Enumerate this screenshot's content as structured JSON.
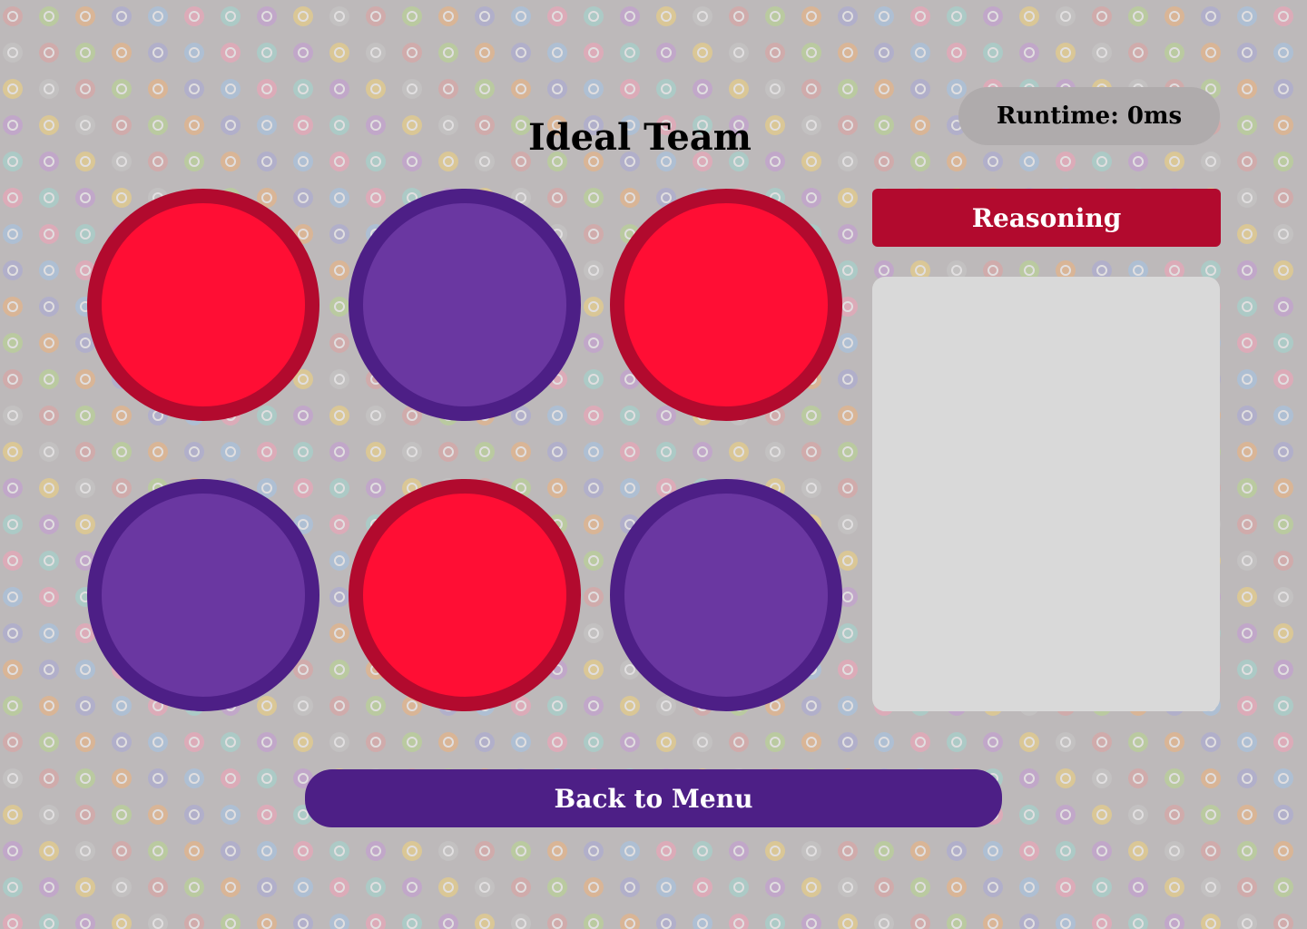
{
  "header": {
    "title": "Ideal Team",
    "runtime": "Runtime: 0ms"
  },
  "team_slots": [
    {
      "color": "red"
    },
    {
      "color": "purple"
    },
    {
      "color": "red"
    },
    {
      "color": "purple"
    },
    {
      "color": "red"
    },
    {
      "color": "purple"
    }
  ],
  "reasoning": {
    "label": "Reasoning",
    "text": ""
  },
  "footer": {
    "back_label": "Back to Menu"
  },
  "colors": {
    "background": "#bdb9ba",
    "red_fill": "#ff0e34",
    "red_ring": "#b20a2e",
    "purple_fill": "#6a37a1",
    "purple_ring": "#4d1f86",
    "panel": "#d9d9d9",
    "runtime_pill": "#afabac",
    "type_icon_palette": [
      "#e0a0a0",
      "#c59ad6",
      "#a3c4e8",
      "#b8d98c",
      "#f3d37a",
      "#f7a1b8",
      "#f0b27a",
      "#c8c8c8",
      "#9fd8d0",
      "#a8a8d8"
    ]
  },
  "background_icon": "type-icon-pattern"
}
